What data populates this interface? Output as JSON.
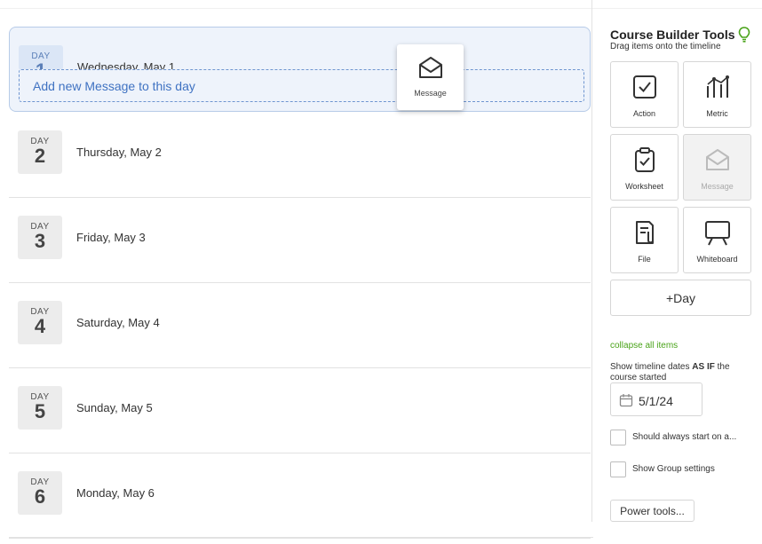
{
  "timeline": {
    "drop_zone_label": "Add new Message to this day",
    "days": [
      {
        "day_label": "DAY",
        "number": "1",
        "date": "Wednesday, May 1"
      },
      {
        "day_label": "DAY",
        "number": "2",
        "date": "Thursday, May 2"
      },
      {
        "day_label": "DAY",
        "number": "3",
        "date": "Friday, May 3"
      },
      {
        "day_label": "DAY",
        "number": "4",
        "date": "Saturday, May 4"
      },
      {
        "day_label": "DAY",
        "number": "5",
        "date": "Sunday, May 5"
      },
      {
        "day_label": "DAY",
        "number": "6",
        "date": "Monday, May 6"
      }
    ]
  },
  "drag_card": {
    "label": "Message",
    "icon": "envelope-open-icon"
  },
  "sidebar": {
    "title": "Course Builder Tools",
    "subtitle": "Drag items onto the timeline",
    "tools": [
      {
        "label": "Action",
        "icon": "checkbox-icon",
        "disabled": false
      },
      {
        "label": "Metric",
        "icon": "metric-chart-icon",
        "disabled": false
      },
      {
        "label": "Worksheet",
        "icon": "clipboard-check-icon",
        "disabled": false
      },
      {
        "label": "Message",
        "icon": "envelope-open-icon",
        "disabled": true
      },
      {
        "label": "File",
        "icon": "file-clip-icon",
        "disabled": false
      },
      {
        "label": "Whiteboard",
        "icon": "whiteboard-icon",
        "disabled": false
      }
    ],
    "add_day_label": "+Day",
    "collapse_label": "collapse all items",
    "show_dates_prefix": "Show timeline dates ",
    "show_dates_emph": "AS IF",
    "show_dates_suffix": " the course started",
    "date_value": "5/1/24",
    "checkbox_always_start": "Should always start on a...",
    "checkbox_group_settings": "Show Group settings",
    "power_tools_label": "Power tools..."
  },
  "colors": {
    "accent_green": "#4aa31a",
    "drop_blue": "#3f72c2"
  }
}
